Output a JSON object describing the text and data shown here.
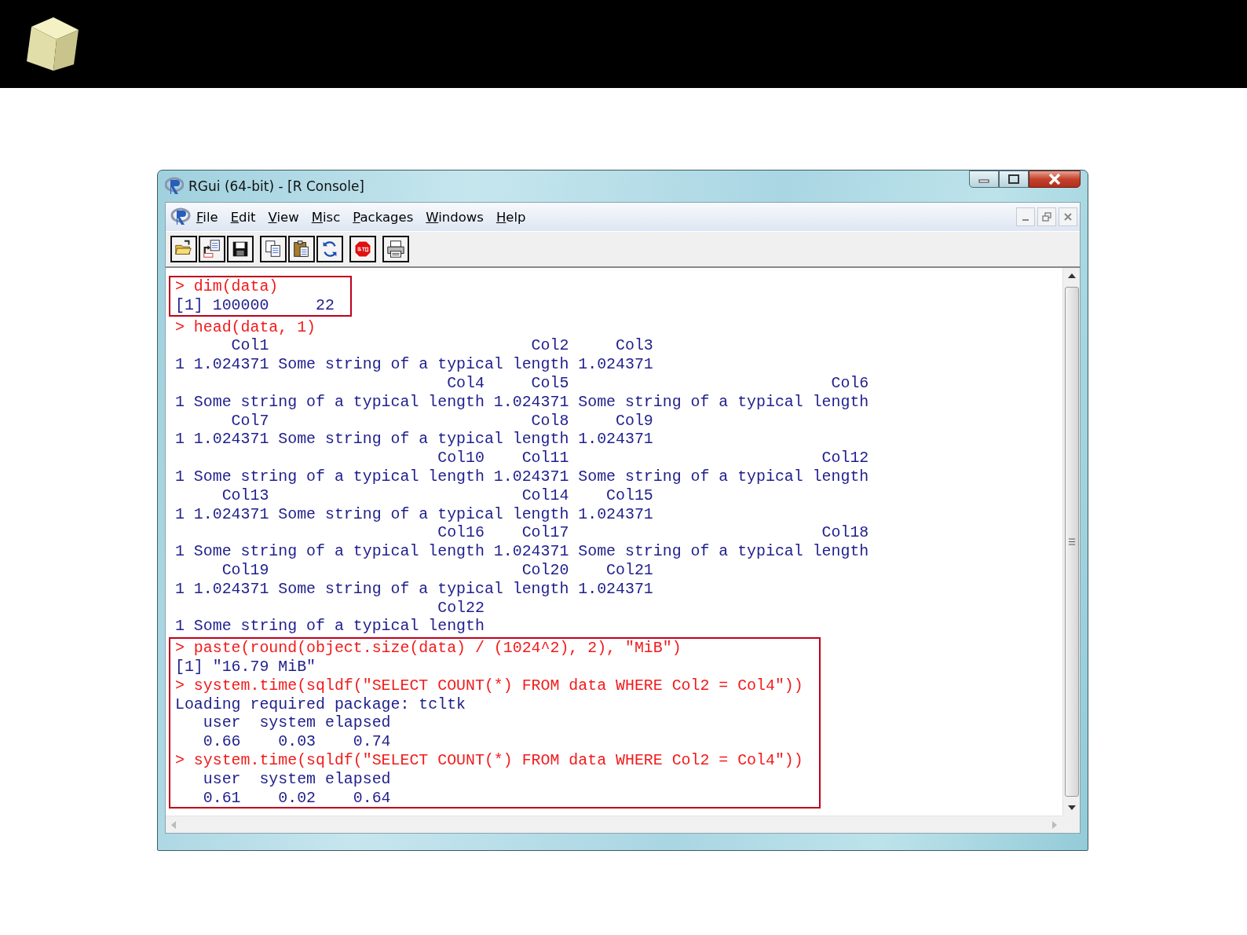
{
  "window": {
    "title": "RGui (64-bit) - [R Console]"
  },
  "menu": [
    "File",
    "Edit",
    "View",
    "Misc",
    "Packages",
    "Windows",
    "Help"
  ],
  "console": {
    "blocks": [
      {
        "highlighted": true,
        "lines": [
          {
            "kind": "input",
            "text": "> dim(data)"
          },
          {
            "kind": "output",
            "text": "[1] 100000     22"
          }
        ]
      },
      {
        "highlighted": false,
        "lines": [
          {
            "kind": "input",
            "text": "> head(data, 1)"
          },
          {
            "kind": "output",
            "text": "      Col1                            Col2     Col3"
          },
          {
            "kind": "output",
            "text": "1 1.024371 Some string of a typical length 1.024371"
          },
          {
            "kind": "output",
            "text": "                             Col4     Col5                            Col6"
          },
          {
            "kind": "output",
            "text": "1 Some string of a typical length 1.024371 Some string of a typical length"
          },
          {
            "kind": "output",
            "text": "      Col7                            Col8     Col9"
          },
          {
            "kind": "output",
            "text": "1 1.024371 Some string of a typical length 1.024371"
          },
          {
            "kind": "output",
            "text": "                            Col10    Col11                           Col12"
          },
          {
            "kind": "output",
            "text": "1 Some string of a typical length 1.024371 Some string of a typical length"
          },
          {
            "kind": "output",
            "text": "     Col13                           Col14    Col15"
          },
          {
            "kind": "output",
            "text": "1 1.024371 Some string of a typical length 1.024371"
          },
          {
            "kind": "output",
            "text": "                            Col16    Col17                           Col18"
          },
          {
            "kind": "output",
            "text": "1 Some string of a typical length 1.024371 Some string of a typical length"
          },
          {
            "kind": "output",
            "text": "     Col19                           Col20    Col21"
          },
          {
            "kind": "output",
            "text": "1 1.024371 Some string of a typical length 1.024371"
          },
          {
            "kind": "output",
            "text": "                            Col22"
          },
          {
            "kind": "output",
            "text": "1 Some string of a typical length"
          }
        ]
      },
      {
        "highlighted": true,
        "lines": [
          {
            "kind": "input",
            "text": "> paste(round(object.size(data) / (1024^2), 2), \"MiB\")"
          },
          {
            "kind": "output",
            "text": "[1] \"16.79 MiB\""
          },
          {
            "kind": "input",
            "text": "> system.time(sqldf(\"SELECT COUNT(*) FROM data WHERE Col2 = Col4\"))"
          },
          {
            "kind": "output",
            "text": "Loading required package: tcltk"
          },
          {
            "kind": "output",
            "text": "   user  system elapsed"
          },
          {
            "kind": "output",
            "text": "   0.66    0.03    0.74"
          },
          {
            "kind": "input",
            "text": "> system.time(sqldf(\"SELECT COUNT(*) FROM data WHERE Col2 = Col4\"))"
          },
          {
            "kind": "output",
            "text": "   user  system elapsed"
          },
          {
            "kind": "output",
            "text": "   0.61    0.02    0.64"
          }
        ]
      }
    ]
  }
}
